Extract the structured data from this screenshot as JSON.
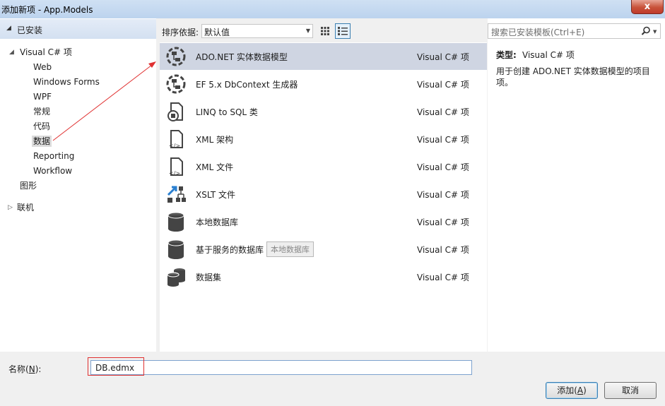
{
  "window": {
    "title": "添加新项 - App.Models",
    "close_label": "x"
  },
  "left_panel": {
    "installed_label": "已安装",
    "tree": [
      {
        "label": "Visual C# 项",
        "level": 0,
        "expander": "expanded"
      },
      {
        "label": "Web",
        "level": 1
      },
      {
        "label": "Windows Forms",
        "level": 1
      },
      {
        "label": "WPF",
        "level": 1
      },
      {
        "label": "常规",
        "level": 1
      },
      {
        "label": "代码",
        "level": 1
      },
      {
        "label": "数据",
        "level": 1,
        "selected": true
      },
      {
        "label": "Reporting",
        "level": 1
      },
      {
        "label": "Workflow",
        "level": 1
      },
      {
        "label": "图形",
        "level": 0
      },
      {
        "label": "联机",
        "level": 0,
        "expander": "collapsed"
      }
    ]
  },
  "toolbar": {
    "sort_label": "排序依据:",
    "sort_value": "默认值"
  },
  "templates": [
    {
      "name": "ADO.NET 实体数据模型",
      "lang": "Visual C# 项",
      "icon": "entity-model-icon",
      "selected": true
    },
    {
      "name": "EF 5.x DbContext 生成器",
      "lang": "Visual C# 项",
      "icon": "dbcontext-generator-icon"
    },
    {
      "name": "LINQ to SQL 类",
      "lang": "Visual C# 项",
      "icon": "linq-to-sql-icon"
    },
    {
      "name": "XML 架构",
      "lang": "Visual C# 项",
      "icon": "xml-schema-icon"
    },
    {
      "name": "XML 文件",
      "lang": "Visual C# 项",
      "icon": "xml-file-icon"
    },
    {
      "name": "XSLT 文件",
      "lang": "Visual C# 项",
      "icon": "xslt-file-icon"
    },
    {
      "name": "本地数据库",
      "lang": "Visual C# 项",
      "icon": "local-database-icon"
    },
    {
      "name": "基于服务的数据库",
      "lang": "Visual C# 项",
      "icon": "service-database-icon",
      "tag": "本地数据库"
    },
    {
      "name": "数据集",
      "lang": "Visual C# 项",
      "icon": "dataset-icon"
    }
  ],
  "right_panel": {
    "search_placeholder": "搜索已安装模板(Ctrl+E)",
    "type_label": "类型:",
    "type_value": "Visual C# 项",
    "description": "用于创建 ADO.NET 实体数据模型的项目项。"
  },
  "bottom": {
    "name_label": "名称",
    "name_mnemonic": "N",
    "name_value": "DB.edmx",
    "add_label": "添加",
    "add_mnemonic": "A",
    "cancel_label": "取消"
  },
  "annotation_color": "#e03030"
}
